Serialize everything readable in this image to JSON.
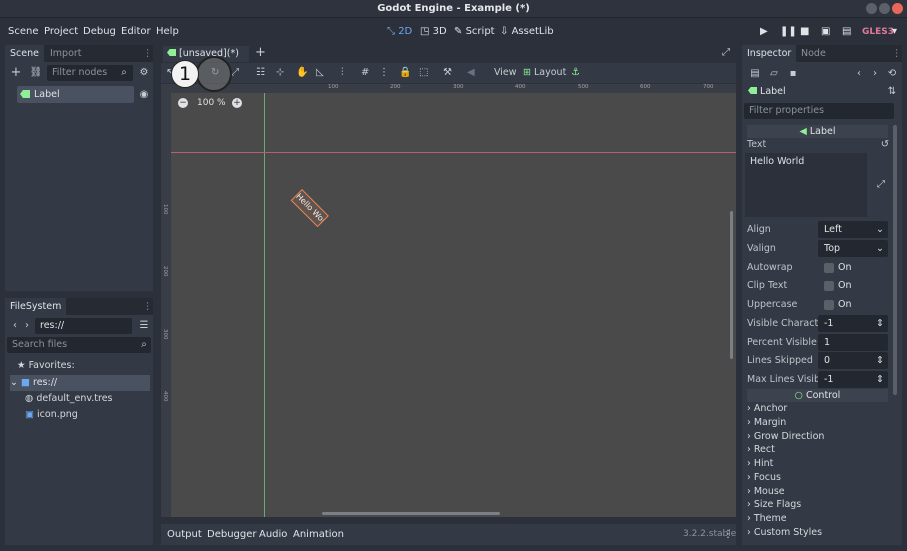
{
  "window": {
    "title": "Godot Engine - Example (*)"
  },
  "menu": {
    "items": [
      "Scene",
      "Project",
      "Debug",
      "Editor",
      "Help"
    ]
  },
  "workspaces": [
    "2D",
    "3D",
    "Script",
    "AssetLib"
  ],
  "renderer": "GLES3",
  "scene_dock": {
    "tabs": [
      "Scene",
      "Import"
    ],
    "filter_placeholder": "Filter nodes",
    "node": "Label"
  },
  "filesystem": {
    "tab": "FileSystem",
    "path": "res://",
    "search_placeholder": "Search files",
    "favorites": "Favorites:",
    "root": "res://",
    "files": [
      "default_env.tres",
      "icon.png"
    ]
  },
  "editor": {
    "tab": "[unsaved](*)",
    "view_label": "View",
    "layout_label": "Layout",
    "zoom": "100 %",
    "badge": "1",
    "canvas_label": "Hello World",
    "ruler_top": [
      "100",
      "200",
      "300",
      "400",
      "500",
      "600",
      "700"
    ],
    "ruler_left": [
      "100",
      "200",
      "300",
      "400"
    ]
  },
  "bottom_panel": {
    "tabs": [
      "Output",
      "Debugger",
      "Audio",
      "Animation"
    ],
    "version": "3.2.2.stable"
  },
  "inspector": {
    "tabs": [
      "Inspector",
      "Node"
    ],
    "node": "Label",
    "filter_placeholder": "Filter properties",
    "class_header": "Label",
    "text_label": "Text",
    "text_value": "Hello World",
    "props": [
      {
        "name": "Align",
        "value": "Left"
      },
      {
        "name": "Valign",
        "value": "Top"
      },
      {
        "name": "Autowrap",
        "value": "On"
      },
      {
        "name": "Clip Text",
        "value": "On"
      },
      {
        "name": "Uppercase",
        "value": "On"
      },
      {
        "name": "Visible Characte",
        "value": "-1"
      },
      {
        "name": "Percent Visible",
        "value": "1"
      },
      {
        "name": "Lines Skipped",
        "value": "0"
      },
      {
        "name": "Max Lines Visibl",
        "value": "-1"
      }
    ],
    "control_header": "Control",
    "sections": [
      "Anchor",
      "Margin",
      "Grow Direction",
      "Rect",
      "Hint",
      "Focus",
      "Mouse",
      "Size Flags",
      "Theme",
      "Custom Styles"
    ]
  },
  "colors": {
    "accent": "#6aa9f2",
    "node_green": "#8eef97",
    "renderer": "#e07a9a"
  }
}
